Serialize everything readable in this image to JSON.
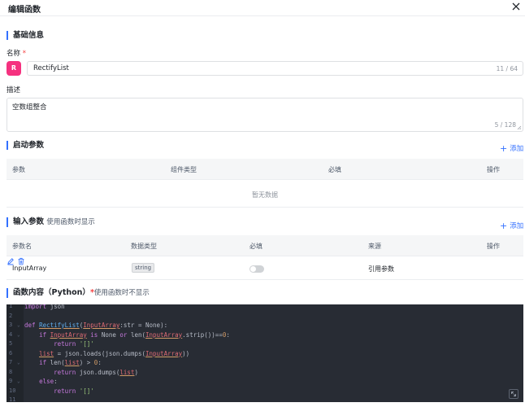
{
  "header": {
    "title": "编辑函数"
  },
  "basic": {
    "section_title": "基础信息",
    "name_label": "名称",
    "required_mark": "*",
    "avatar_letter": "R",
    "name_value": "RectifyList",
    "name_count": "11 / 64",
    "desc_label": "描述",
    "desc_value": "空数组整合",
    "desc_count": "5 / 128"
  },
  "startup": {
    "section_title": "启动参数",
    "add_label": "添加",
    "columns": [
      "参数",
      "组件类型",
      "必填",
      "操作"
    ],
    "empty_text": "暂无数据"
  },
  "inputs": {
    "section_title": "输入参数",
    "section_sub": "使用函数时显示",
    "add_label": "添加",
    "columns": [
      "参数名",
      "数据类型",
      "必填",
      "来源",
      "操作"
    ],
    "rows": [
      {
        "name": "InputArray",
        "type": "string",
        "required": false,
        "source": "引用参数"
      }
    ]
  },
  "code": {
    "section_title": "函数内容（Python）",
    "required_mark": "*",
    "section_sub": "使用函数时不显示",
    "line_numbers": [
      "1",
      "2",
      "3",
      "4",
      "5",
      "6",
      "7",
      "8",
      "9",
      "10",
      "11"
    ]
  },
  "colors": {
    "accent": "#3370ff",
    "avatar": "#f5317f",
    "required": "#f53f3f",
    "editor_bg": "#282c34"
  },
  "icons": [
    "close-icon",
    "plus-icon",
    "edit-icon",
    "delete-icon",
    "expand-icon",
    "fold-arrow-icon"
  ]
}
